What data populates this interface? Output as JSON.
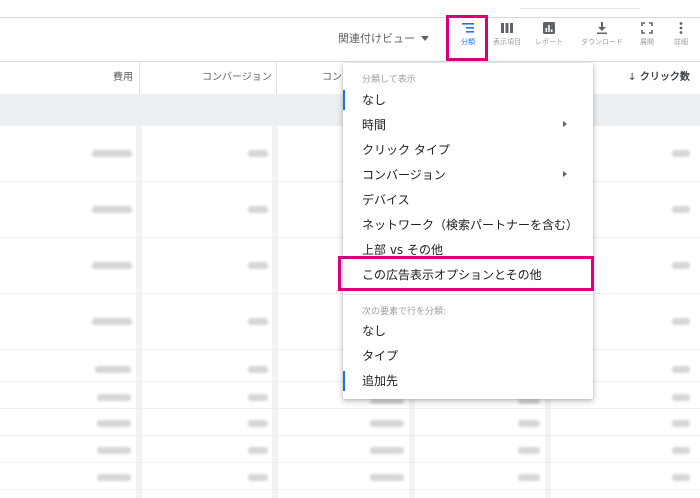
{
  "toolbar": {
    "segment_view_label": "関連付けビュー",
    "buttons": [
      {
        "label": "分類",
        "icon": "segment-icon",
        "active": true
      },
      {
        "label": "表示項目",
        "icon": "columns-icon",
        "active": false
      },
      {
        "label": "レポート",
        "icon": "report-icon",
        "active": false
      },
      {
        "label": "ダウンロード",
        "icon": "download-icon",
        "active": false
      },
      {
        "label": "展開",
        "icon": "expand-icon",
        "active": false
      },
      {
        "label": "詳細",
        "icon": "more-vertical-icon",
        "active": false
      }
    ]
  },
  "table": {
    "columns": {
      "cost": "費用",
      "conversions": "コンバージョン",
      "conversions_truncated": "コン",
      "clicks": "クリック数"
    }
  },
  "menu": {
    "segment_header": "分類して表示",
    "items": [
      "なし",
      "時間",
      "クリック タイプ",
      "コンバージョン",
      "デバイス",
      "ネットワーク（検索パートナーを含む）",
      "上部 vs その他",
      "この広告表示オプションとその他"
    ],
    "filter_header": "次の要素で行を分類:",
    "filter_items": [
      "なし",
      "タイプ",
      "追加先"
    ]
  },
  "colors": {
    "highlight": "#d4007e",
    "accent": "#1a73e8"
  }
}
